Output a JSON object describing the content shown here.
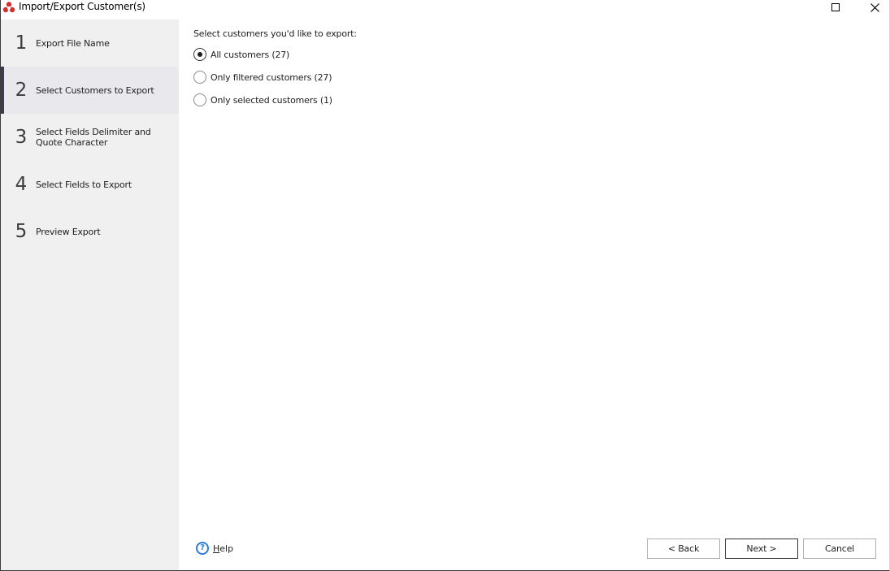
{
  "window": {
    "title": "Import/Export Customer(s)",
    "app_icon": "app-logo-icon",
    "controls": [
      "maximize",
      "close"
    ]
  },
  "sidebar": {
    "steps": [
      {
        "number": "1",
        "label": "Export File Name",
        "active": false
      },
      {
        "number": "2",
        "label": "Select Customers to Export",
        "active": true
      },
      {
        "number": "3",
        "label": "Select Fields Delimiter and Quote Character",
        "active": false
      },
      {
        "number": "4",
        "label": "Select Fields to Export",
        "active": false
      },
      {
        "number": "5",
        "label": "Preview Export",
        "active": false
      }
    ]
  },
  "main": {
    "prompt": "Select customers you'd like to export:",
    "options": [
      {
        "label": "All customers (27)",
        "checked": true
      },
      {
        "label": "Only filtered customers (27)",
        "checked": false
      },
      {
        "label": "Only selected customers (1)",
        "checked": false
      }
    ]
  },
  "footer": {
    "help_label": "Help",
    "help_accesskey": "H",
    "back_label": "< Back",
    "next_label": "Next >",
    "cancel_label": "Cancel"
  },
  "colors": {
    "sidebar_bg": "#f0f0f0",
    "active_step_bg": "#e8e8ed",
    "active_indicator": "#3e3e4a",
    "help_icon": "#2b7bd8",
    "logo": "#d0312d"
  }
}
